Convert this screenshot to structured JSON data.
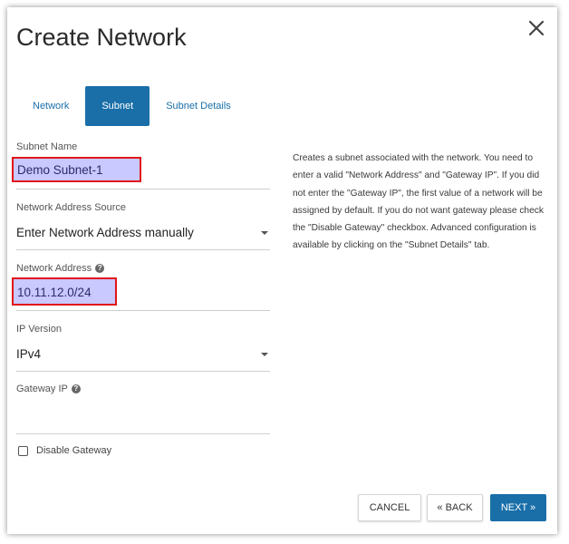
{
  "dialog": {
    "title": "Create Network"
  },
  "tabs": [
    {
      "label": "Network",
      "active": false
    },
    {
      "label": "Subnet",
      "active": true
    },
    {
      "label": "Subnet Details",
      "active": false
    }
  ],
  "form": {
    "subnet_name": {
      "label": "Subnet Name",
      "value": "Demo Subnet-1"
    },
    "network_address_source": {
      "label": "Network Address Source",
      "value": "Enter Network Address manually"
    },
    "network_address": {
      "label": "Network Address",
      "value": "10.11.12.0/24"
    },
    "ip_version": {
      "label": "IP Version",
      "value": "IPv4"
    },
    "gateway_ip": {
      "label": "Gateway IP",
      "value": ""
    },
    "disable_gateway": {
      "label": "Disable Gateway",
      "checked": false
    }
  },
  "help_text": "Creates a subnet associated with the network. You need to enter a valid \"Network Address\" and \"Gateway IP\". If you did not enter the \"Gateway IP\", the first value of a network will be assigned by default. If you do not want gateway please check the \"Disable Gateway\" checkbox. Advanced configuration is available by clicking on the \"Subnet Details\" tab.",
  "buttons": {
    "cancel": "CANCEL",
    "back": "« BACK",
    "next": "NEXT »"
  },
  "icons": {
    "close": "close-icon",
    "help": "question-circle-icon",
    "dropdown": "caret-down-icon"
  },
  "colors": {
    "accent": "#1a6fa8",
    "highlight_fill": "#c9c8ff",
    "highlight_border": "#e0161c"
  }
}
